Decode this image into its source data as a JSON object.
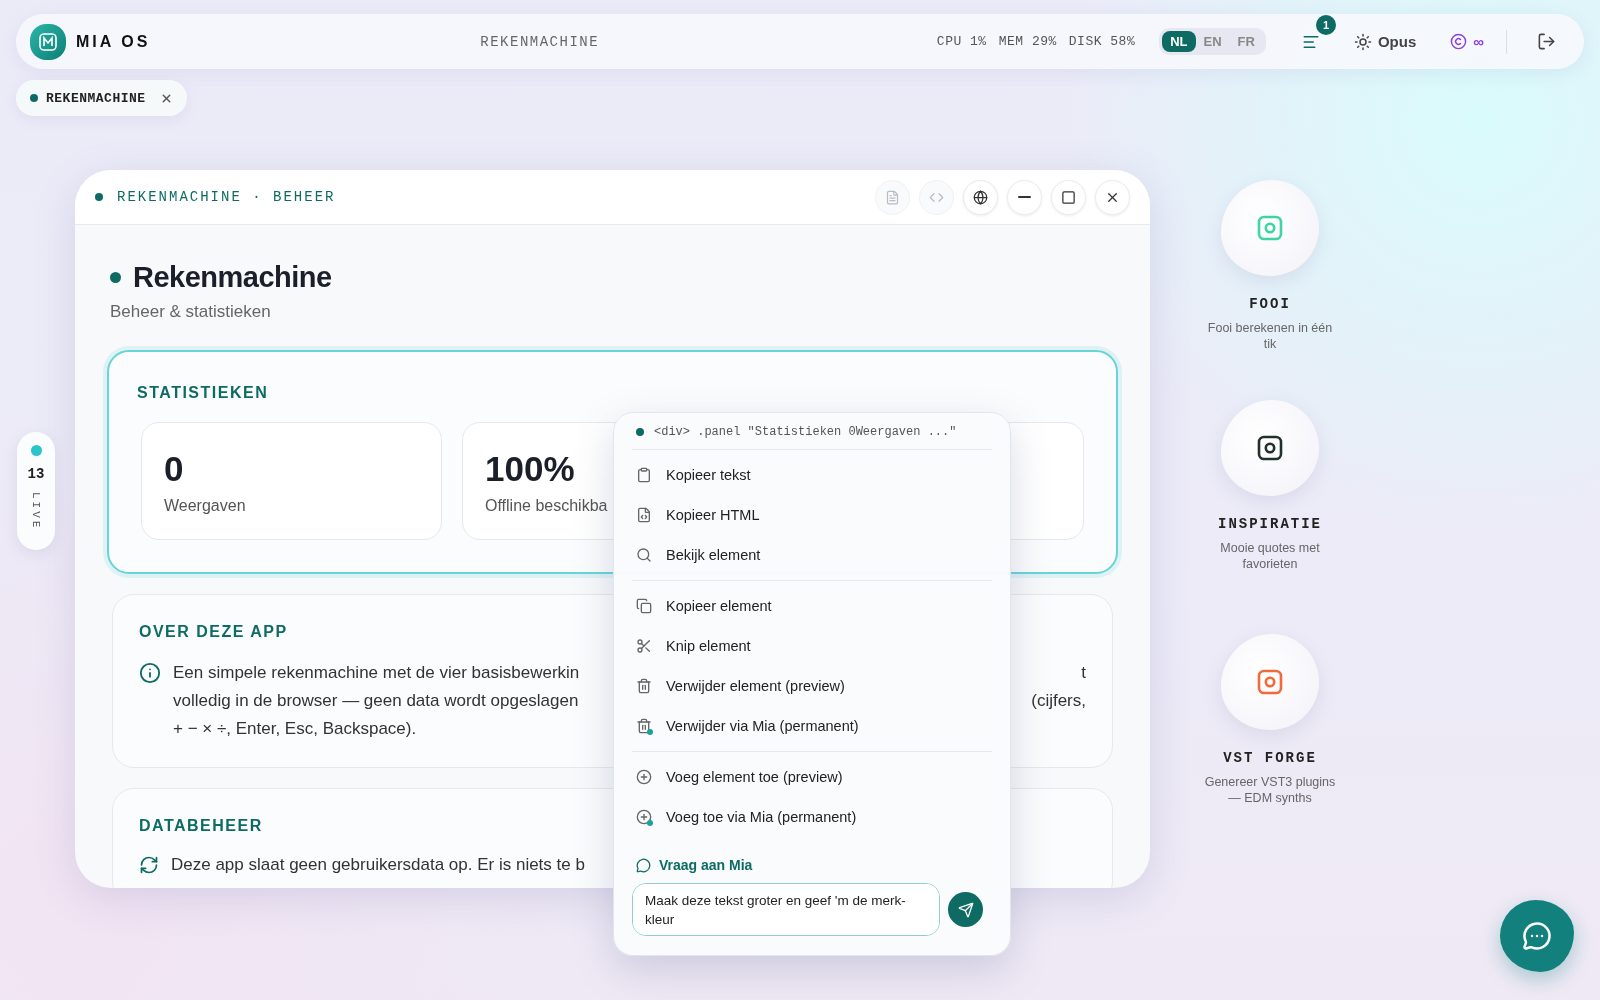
{
  "topbar": {
    "brand": "MIA OS",
    "title": "REKENMACHINE",
    "stats": [
      "CPU 1%",
      "MEM 29%",
      "DISK 58%"
    ],
    "languages": [
      {
        "label": "NL",
        "selected": true
      },
      {
        "label": "EN",
        "selected": false
      },
      {
        "label": "FR",
        "selected": false
      }
    ],
    "notifications": "1",
    "model": "Opus",
    "credits": "∞"
  },
  "open_tabs": [
    {
      "label": "REKENMACHINE"
    }
  ],
  "live": {
    "count": "13",
    "label": "LIVE"
  },
  "window": {
    "title": "REKENMACHINE · BEHEER",
    "controls": [
      {
        "kind": "document",
        "disabled": true
      },
      {
        "kind": "code",
        "disabled": true
      },
      {
        "kind": "globe",
        "disabled": false
      },
      {
        "kind": "minimize",
        "disabled": false
      },
      {
        "kind": "maximize",
        "disabled": false
      },
      {
        "kind": "close",
        "disabled": false
      }
    ],
    "heading": "Rekenmachine",
    "subtitle": "Beheer & statistieken",
    "stats_panel": {
      "title": "STATISTIEKEN",
      "selected": true,
      "stats": [
        {
          "kind": "stat",
          "value": "0",
          "label": "Weergaven"
        },
        {
          "kind": "stat",
          "value": "100%",
          "label": "Offline beschikba"
        },
        {
          "kind": "covered"
        }
      ]
    },
    "about": {
      "title": "OVER DEZE APP",
      "lines": [
        "Een simpele rekenmachine met de vier basisbewerkin",
        "volledig in de browser — geen data wordt opgeslagen",
        "+ − × ÷, Enter, Esc, Backspace)."
      ],
      "fragments": [
        "t",
        "(cijfers,"
      ]
    },
    "data": {
      "title": "DATABEHEER",
      "text": "Deze app slaat geen gebruikersdata op. Er is niets te b"
    }
  },
  "context_menu": {
    "target": "<div> .panel \"Statistieken 0Weergaven ...\"",
    "groups": [
      {
        "items": [
          {
            "kind": "copy-text",
            "label": "Kopieer tekst"
          },
          {
            "kind": "copy-html",
            "label": "Kopieer HTML"
          },
          {
            "kind": "inspect",
            "label": "Bekijk element"
          }
        ]
      },
      {
        "items": [
          {
            "kind": "copy",
            "label": "Kopieer element"
          },
          {
            "kind": "cut",
            "label": "Knip element"
          },
          {
            "kind": "delete",
            "label": "Verwijder element (preview)"
          },
          {
            "kind": "delete-ai",
            "label": "Verwijder via Mia (permanent)"
          }
        ]
      },
      {
        "items": [
          {
            "kind": "add",
            "label": "Voeg element toe (preview)"
          },
          {
            "kind": "add-ai",
            "label": "Voeg toe via Mia (permanent)"
          }
        ]
      }
    ],
    "ask": {
      "label": "Vraag aan Mia",
      "value": "Maak deze tekst groter en geef 'm de merk-kleur"
    }
  },
  "apps": [
    {
      "name": "FOOI",
      "description": "Fooi berekenen in één tik",
      "color": "#3dd6a0"
    },
    {
      "name": "INSPIRATIE",
      "description": "Mooie quotes met favorieten",
      "color": "#22302c"
    },
    {
      "name": "VST FORGE",
      "description": "Genereer VST3 plugins — EDM synths",
      "color": "#f06a3a"
    }
  ]
}
